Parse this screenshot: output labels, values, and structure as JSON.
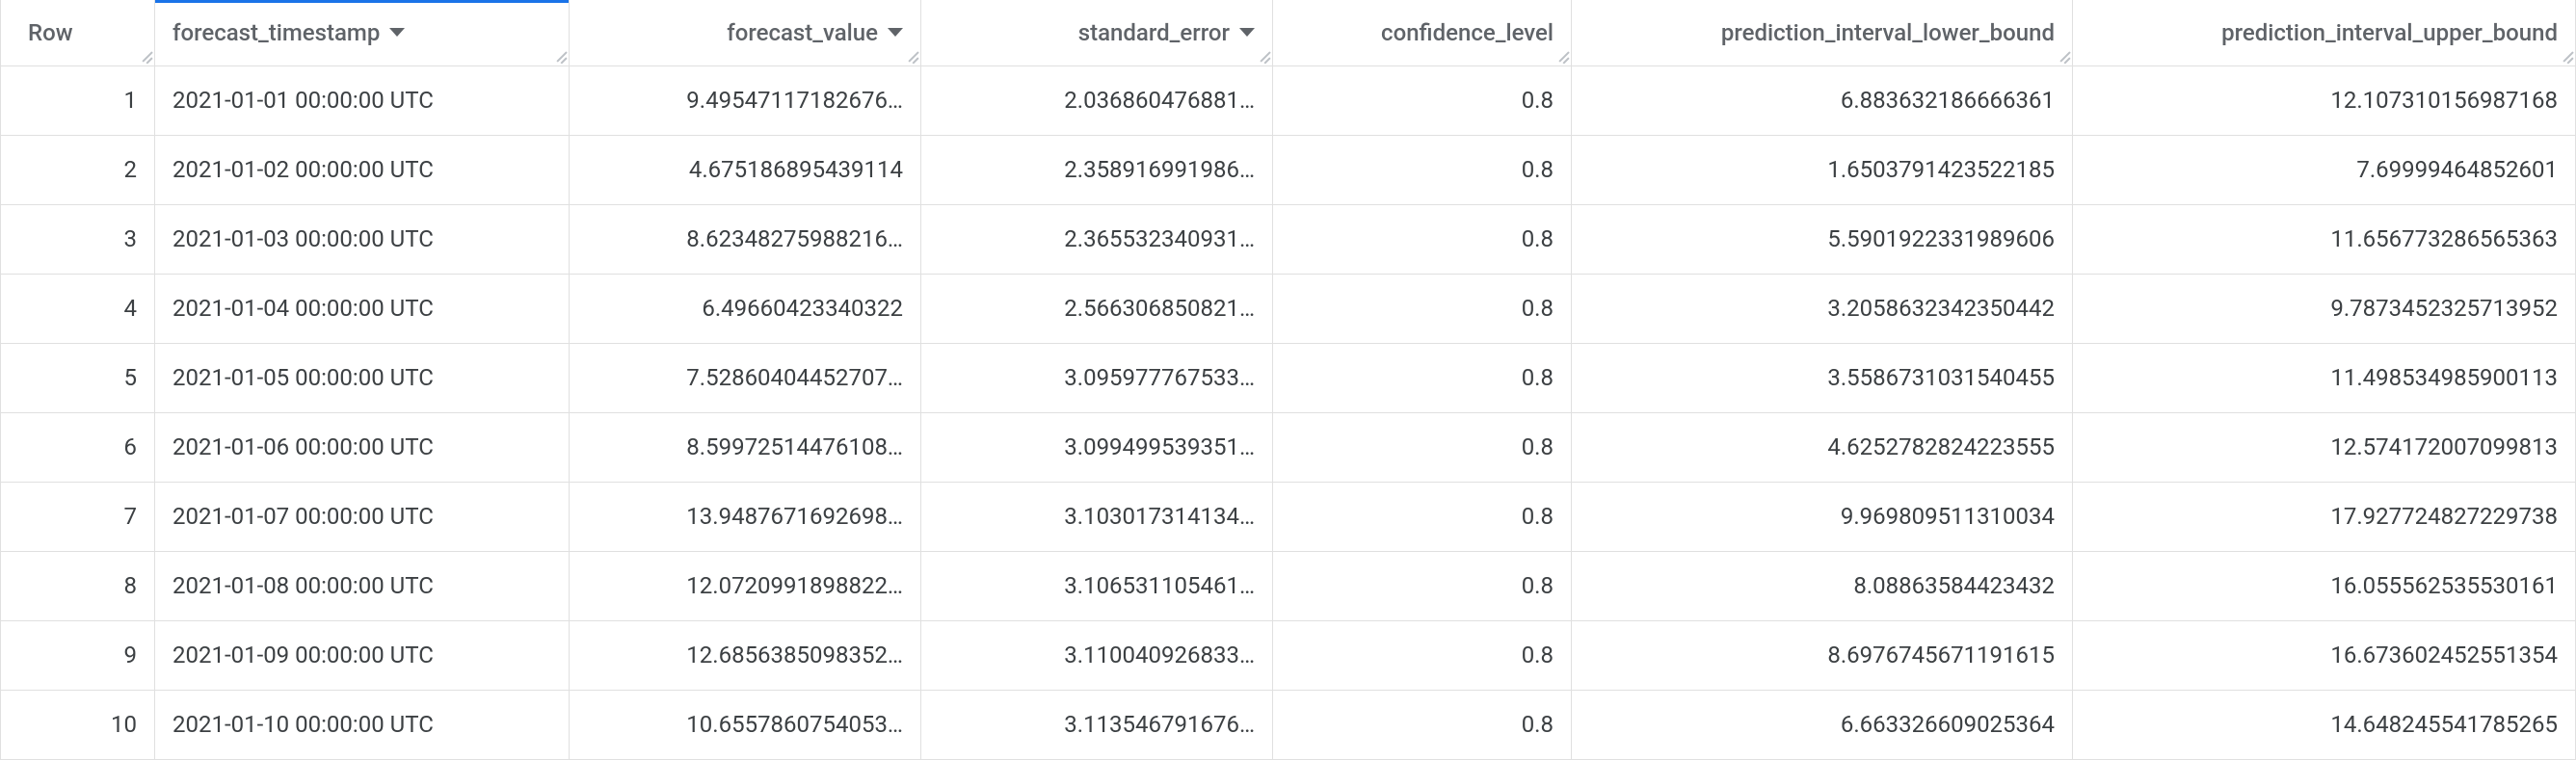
{
  "columns": {
    "row": {
      "label": "Row",
      "sortable": false
    },
    "ts": {
      "label": "forecast_timestamp",
      "sortable": true
    },
    "fv": {
      "label": "forecast_value",
      "sortable": true
    },
    "se": {
      "label": "standard_error",
      "sortable": true
    },
    "cl": {
      "label": "confidence_level",
      "sortable": false
    },
    "lower": {
      "label": "prediction_interval_lower_bound",
      "sortable": false
    },
    "upper": {
      "label": "prediction_interval_upper_bound",
      "sortable": false
    }
  },
  "rows": [
    {
      "row": "1",
      "ts": "2021-01-01 00:00:00 UTC",
      "fv": "9.49547117182676…",
      "se": "2.036860476881…",
      "cl": "0.8",
      "lower": "6.883632186666361",
      "upper": "12.107310156987168"
    },
    {
      "row": "2",
      "ts": "2021-01-02 00:00:00 UTC",
      "fv": "4.675186895439114",
      "se": "2.358916991986…",
      "cl": "0.8",
      "lower": "1.6503791423522185",
      "upper": "7.69999464852601"
    },
    {
      "row": "3",
      "ts": "2021-01-03 00:00:00 UTC",
      "fv": "8.62348275988216…",
      "se": "2.365532340931…",
      "cl": "0.8",
      "lower": "5.5901922331989606",
      "upper": "11.656773286565363"
    },
    {
      "row": "4",
      "ts": "2021-01-04 00:00:00 UTC",
      "fv": "6.49660423340322",
      "se": "2.566306850821…",
      "cl": "0.8",
      "lower": "3.2058632342350442",
      "upper": "9.7873452325713952"
    },
    {
      "row": "5",
      "ts": "2021-01-05 00:00:00 UTC",
      "fv": "7.52860404452707…",
      "se": "3.095977767533…",
      "cl": "0.8",
      "lower": "3.5586731031540455",
      "upper": "11.498534985900113"
    },
    {
      "row": "6",
      "ts": "2021-01-06 00:00:00 UTC",
      "fv": "8.59972514476108…",
      "se": "3.099499539351…",
      "cl": "0.8",
      "lower": "4.6252782824223555",
      "upper": "12.574172007099813"
    },
    {
      "row": "7",
      "ts": "2021-01-07 00:00:00 UTC",
      "fv": "13.9487671692698…",
      "se": "3.103017314134…",
      "cl": "0.8",
      "lower": "9.969809511310034",
      "upper": "17.927724827229738"
    },
    {
      "row": "8",
      "ts": "2021-01-08 00:00:00 UTC",
      "fv": "12.0720991898822…",
      "se": "3.106531105461…",
      "cl": "0.8",
      "lower": "8.08863584423432",
      "upper": "16.055562535530161"
    },
    {
      "row": "9",
      "ts": "2021-01-09 00:00:00 UTC",
      "fv": "12.6856385098352…",
      "se": "3.110040926833…",
      "cl": "0.8",
      "lower": "8.6976745671191615",
      "upper": "16.673602452551354"
    },
    {
      "row": "10",
      "ts": "2021-01-10 00:00:00 UTC",
      "fv": "10.6557860754053…",
      "se": "3.113546791676…",
      "cl": "0.8",
      "lower": "6.663326609025364",
      "upper": "14.648245541785265"
    }
  ]
}
